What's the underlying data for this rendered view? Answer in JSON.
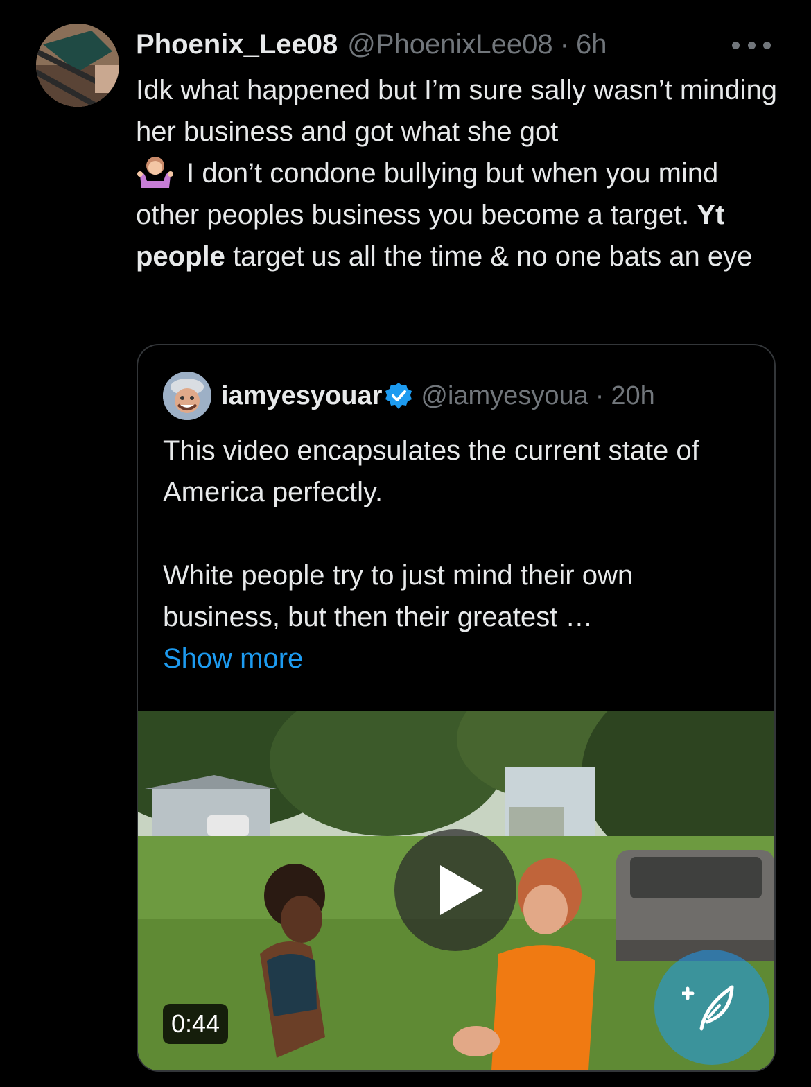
{
  "tweet": {
    "author": {
      "display_name": "Phoenix_Lee08",
      "handle": "@PhoenixLee08",
      "separator": "·",
      "time": "6h"
    },
    "text_part1": "Idk what happened but I’m sure sally wasn’t minding her business and got what she got",
    "emoji": "🤷🏼‍♀️",
    "text_part2": " I don’t condone bullying but when you mind other peoples business you become a target. ",
    "text_bold": "Yt people",
    "text_part3": " target us all the time & no one bats an eye",
    "more_icon": "more-options-icon"
  },
  "quoted_tweet": {
    "author": {
      "display_name": "iamyesyouar",
      "verified_icon": "verified-badge-icon",
      "handle": "@iamyesyoua",
      "separator": "·",
      "time": "20h"
    },
    "text": "This video encapsulates the current state of America perfectly.\n\nWhite people try to just mind their own business, but then their greatest …",
    "show_more_label": "Show more",
    "video": {
      "duration": "0:44",
      "play_icon": "play-icon",
      "fab_icon": "compose-post-icon"
    }
  },
  "colors": {
    "background": "#000000",
    "text_primary": "#e7e9ea",
    "text_secondary": "#71767b",
    "accent": "#1d9bf0",
    "border": "#333639"
  }
}
